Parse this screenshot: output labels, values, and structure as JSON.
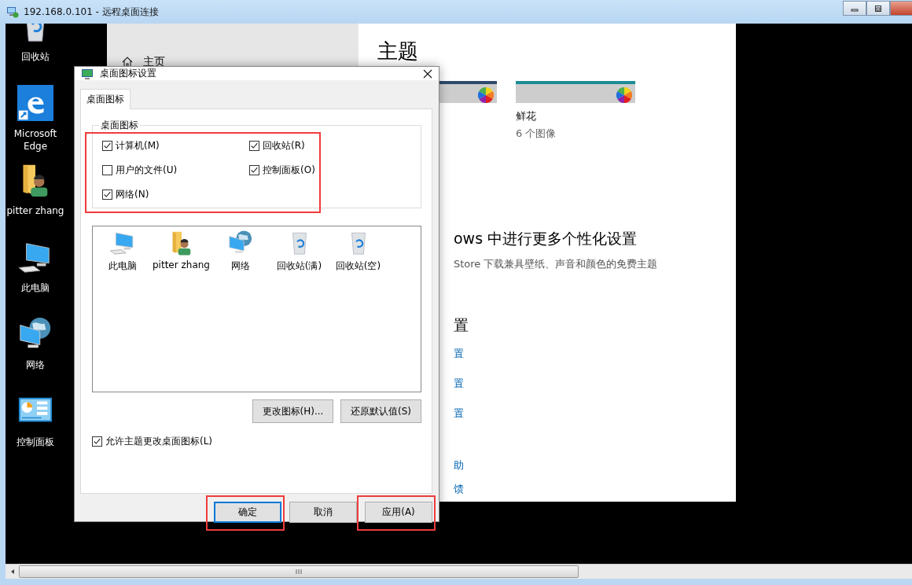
{
  "window": {
    "title": "192.168.0.101 - 远程桌面连接"
  },
  "desktop_icons": [
    {
      "label": "回收站",
      "kind": "recycle"
    },
    {
      "label": "Microsoft Edge",
      "kind": "edge"
    },
    {
      "label": "pitter zhang",
      "kind": "user"
    },
    {
      "label": "此电脑",
      "kind": "computer"
    },
    {
      "label": "网络",
      "kind": "network"
    },
    {
      "label": "控制面板",
      "kind": "control_panel"
    }
  ],
  "settings": {
    "nav": [
      {
        "label": "主页"
      }
    ],
    "heading": "主题",
    "themes": [
      {
        "kind": "partial"
      },
      {
        "kind": "full",
        "name": "鲜花",
        "count": "6 个图像"
      }
    ],
    "more_heading": "ows 中进行更多个性化设置",
    "more_text": "Store 下载兼具壁纸、声音和颜色的免费主题",
    "related_heading": "置",
    "link_groups": [
      [
        "置",
        "置",
        "置"
      ],
      [
        "助",
        "馈"
      ]
    ]
  },
  "dialog": {
    "title": "桌面图标设置",
    "tabs": [
      {
        "label": "桌面图标",
        "selected": true
      }
    ],
    "group": {
      "title": "桌面图标",
      "highlighted": true,
      "options": [
        {
          "label": "计算机(M)",
          "checked": true
        },
        {
          "label": "回收站(R)",
          "checked": true
        },
        {
          "label": "用户的文件(U)",
          "checked": false
        },
        {
          "label": "控制面板(O)",
          "checked": true
        },
        {
          "label": "网络(N)",
          "checked": true
        }
      ]
    },
    "icons": [
      {
        "label": "此电脑",
        "kind": "computer"
      },
      {
        "label": "pitter zhang",
        "kind": "user"
      },
      {
        "label": "网络",
        "kind": "network"
      },
      {
        "label": "回收站(满)",
        "kind": "recycle"
      },
      {
        "label": "回收站(空)",
        "kind": "recycle"
      }
    ],
    "icon_buttons": [
      "更改图标(H)...",
      "还原默认值(S)"
    ],
    "allow_themes": {
      "label": "允许主题更改桌面图标(L)",
      "checked": true
    },
    "buttons": [
      {
        "label": "确定",
        "default": true,
        "highlighted": true
      },
      {
        "label": "取消",
        "default": false,
        "highlighted": false
      },
      {
        "label": "应用(A)",
        "default": false,
        "highlighted": true
      }
    ]
  }
}
